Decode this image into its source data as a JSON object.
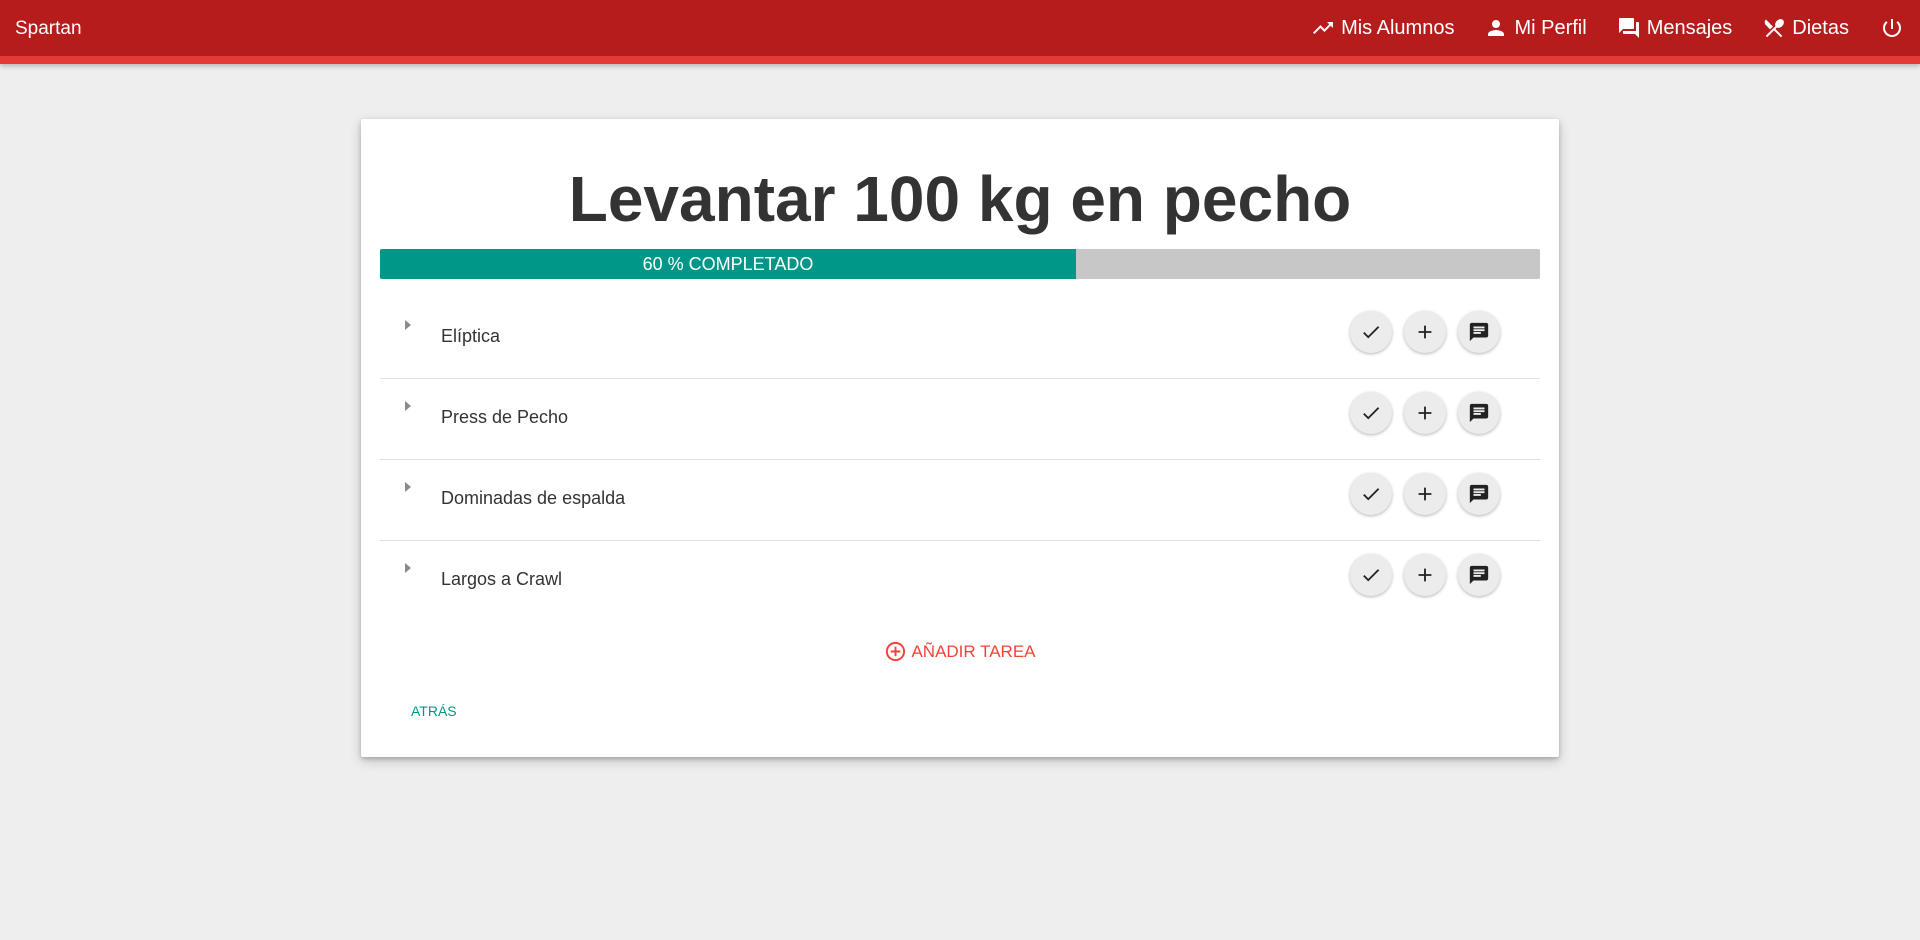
{
  "app": {
    "brand": "Spartan"
  },
  "nav": {
    "items": [
      {
        "label": "Mis Alumnos",
        "icon": "trending-up-icon"
      },
      {
        "label": "Mi Perfil",
        "icon": "person-icon"
      },
      {
        "label": "Mensajes",
        "icon": "forum-icon"
      },
      {
        "label": "Dietas",
        "icon": "restaurant-icon"
      }
    ],
    "power_icon": "power-icon"
  },
  "goal": {
    "title": "Levantar 100 kg en pecho",
    "progress_percent": 60,
    "progress_label": "60 % COMPLETADO"
  },
  "tasks": [
    {
      "name": "Elíptica"
    },
    {
      "name": "Press de Pecho"
    },
    {
      "name": "Dominadas de espalda"
    },
    {
      "name": "Largos a Crawl"
    }
  ],
  "actions": {
    "add_task_label": "AÑADIR TAREA",
    "back_label": "ATRÁS"
  },
  "colors": {
    "header": "#b71c1c",
    "header_accent": "#e53935",
    "progress_fill": "#009688",
    "progress_track": "#c7c7c7",
    "add_task": "#f44336",
    "back": "#009688"
  }
}
